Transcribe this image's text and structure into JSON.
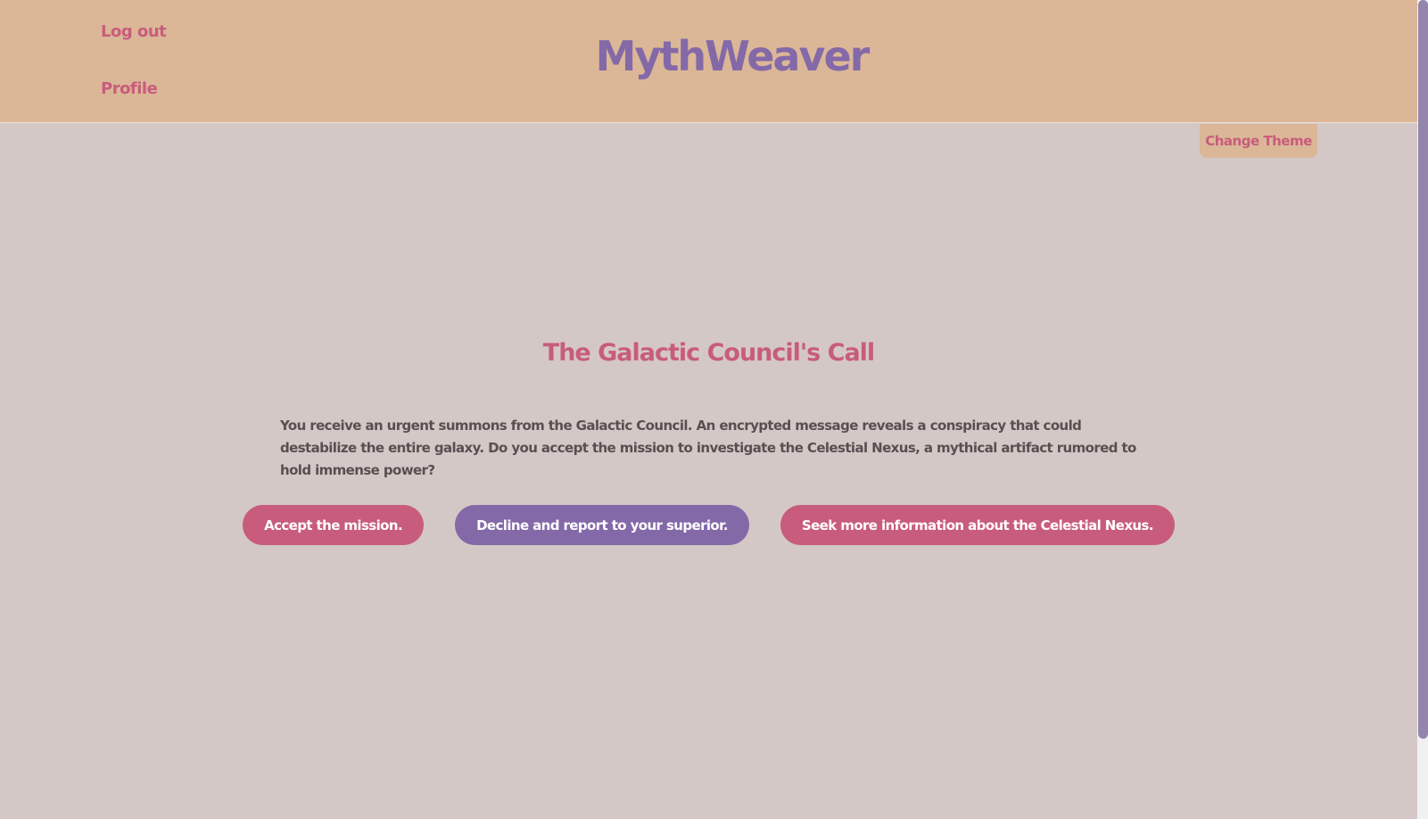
{
  "header": {
    "brand": "MythWeaver",
    "nav": {
      "logout": "Log out",
      "profile": "Profile"
    }
  },
  "toolbar": {
    "change_theme": "Change Theme"
  },
  "story": {
    "title": "The Galactic Council's Call",
    "text": "You receive an urgent summons from the Galactic Council. An encrypted message reveals a conspiracy that could destabilize the entire galaxy. Do you accept the mission to investigate the Celestial Nexus, a mythical artifact rumored to hold immense power?",
    "choices": [
      {
        "label": "Accept the mission.",
        "color": "#c85c7c"
      },
      {
        "label": "Decline and report to your superior.",
        "color": "#8469a8"
      },
      {
        "label": "Seek more information about the Celestial Nexus.",
        "color": "#c85c7c"
      }
    ]
  },
  "colors": {
    "header_bg": "#dbb797",
    "page_bg": "#d4c8c6",
    "accent_pink": "#c85c7c",
    "accent_purple": "#8469a8",
    "body_text": "#5a4e52"
  }
}
